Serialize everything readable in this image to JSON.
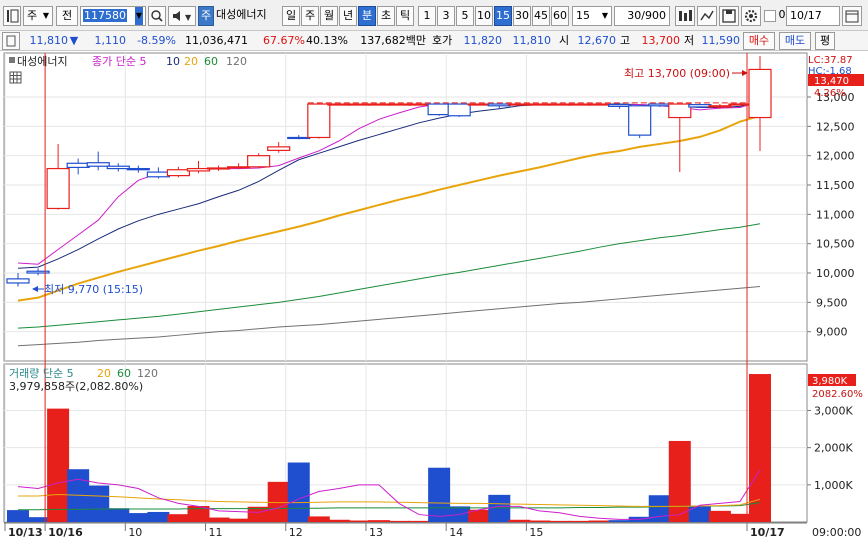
{
  "toolbar": {
    "type_label": "주",
    "stock_type_label": "전",
    "stock_code": "117580",
    "stock_tag": "주",
    "stock_name": "대성에너지",
    "periods": [
      "일",
      "주",
      "월",
      "년",
      "분",
      "초",
      "틱"
    ],
    "selected_period": "분",
    "intervals": [
      "1",
      "3",
      "5",
      "10",
      "15",
      "30",
      "45",
      "60"
    ],
    "selected_interval": "15",
    "interval_value": "15",
    "count": "30/900",
    "date": "10/17",
    "checkbox_value": "0"
  },
  "quote": {
    "price": "11,810",
    "change_arrow": "▼",
    "change": "1,110",
    "change_pct": "-8.59%",
    "volume": "11,036,471",
    "volume_ratio": "67.67%",
    "turnover": "40.13%",
    "amount": "137,682백만",
    "hoga_label": "호가",
    "ask": "11,820",
    "bid": "11,810",
    "open_label": "시",
    "open": "12,670",
    "high_label": "고",
    "high": "13,700",
    "low_label": "저",
    "low": "11,590",
    "buy_label": "매수",
    "sell_label": "매도",
    "eval_label": "평"
  },
  "price_legend": {
    "name": "대성에너지",
    "close_label": "종가 단순 5",
    "ma": [
      "10",
      "20",
      "60",
      "120"
    ]
  },
  "volume_legend": {
    "label": "거래량 단순 5",
    "ma": [
      "20",
      "60",
      "120"
    ],
    "info": "3,979,858주(2,082.80%)"
  },
  "annotations": {
    "high": "최고 13,700 (09:00)",
    "low": "최저 9,770 (15:15)"
  },
  "right_axis": {
    "lc": "LC:37.87",
    "hc": "HC:-1.68",
    "price_tag": "13,470",
    "pct": "4.26%",
    "vol_tag": "3,980K",
    "vol_pct": "2082.60%",
    "time": "09:00:00"
  },
  "colors": {
    "up": "#e8201c",
    "down": "#1f4fcf",
    "ma5": "#cc1fcc",
    "ma10": "#1a2c7a",
    "ma20": "#e8a40a",
    "ma60": "#1a8c3a",
    "ma120": "#707070"
  },
  "chart_data": {
    "type": "candlestick",
    "price_axis": [
      "13,000",
      "12,500",
      "12,000",
      "11,500",
      "11,000",
      "10,500",
      "10,000",
      "9,500",
      "9,000"
    ],
    "volume_axis": [
      "3,000K",
      "2,000K",
      "1,000K"
    ],
    "x_labels": [
      "10/13",
      "10/16",
      "10",
      "11",
      "12",
      "13",
      "14",
      "15",
      "10/17"
    ],
    "candles": [
      {
        "o": 9900,
        "c": 9830,
        "h": 10000,
        "l": 9770,
        "v": 320000
      },
      {
        "o": 10030,
        "c": 10000,
        "h": 10080,
        "l": 9960,
        "v": 130000
      },
      {
        "o": 11100,
        "c": 11780,
        "h": 12200,
        "l": 11080,
        "v": 3050000
      },
      {
        "o": 11870,
        "c": 11800,
        "h": 11950,
        "l": 11680,
        "v": 1420000
      },
      {
        "o": 11880,
        "c": 11820,
        "h": 12070,
        "l": 11750,
        "v": 980000
      },
      {
        "o": 11820,
        "c": 11780,
        "h": 11870,
        "l": 11730,
        "v": 370000
      },
      {
        "o": 11780,
        "c": 11760,
        "h": 11830,
        "l": 11710,
        "v": 240000
      },
      {
        "o": 11720,
        "c": 11640,
        "h": 11800,
        "l": 11610,
        "v": 270000
      },
      {
        "o": 11660,
        "c": 11760,
        "h": 11810,
        "l": 11630,
        "v": 210000
      },
      {
        "o": 11740,
        "c": 11780,
        "h": 11910,
        "l": 11700,
        "v": 430000
      },
      {
        "o": 11780,
        "c": 11790,
        "h": 11830,
        "l": 11740,
        "v": 120000
      },
      {
        "o": 11800,
        "c": 11810,
        "h": 11870,
        "l": 11770,
        "v": 90000
      },
      {
        "o": 11810,
        "c": 12000,
        "h": 12040,
        "l": 11790,
        "v": 410000
      },
      {
        "o": 12090,
        "c": 12150,
        "h": 12230,
        "l": 12050,
        "v": 1080000
      },
      {
        "o": 12310,
        "c": 12300,
        "h": 12350,
        "l": 12280,
        "v": 1600000
      },
      {
        "o": 12310,
        "c": 12880,
        "h": 12900,
        "l": 12290,
        "v": 150000
      },
      {
        "o": 12880,
        "c": 12880,
        "h": 12880,
        "l": 12880,
        "v": 60000
      },
      {
        "o": 12880,
        "c": 12880,
        "h": 12880,
        "l": 12880,
        "v": 40000
      },
      {
        "o": 12880,
        "c": 12880,
        "h": 12880,
        "l": 12880,
        "v": 50000
      },
      {
        "o": 12880,
        "c": 12880,
        "h": 12880,
        "l": 12880,
        "v": 30000
      },
      {
        "o": 12880,
        "c": 12880,
        "h": 12880,
        "l": 12880,
        "v": 30000
      },
      {
        "o": 12880,
        "c": 12700,
        "h": 12880,
        "l": 12680,
        "v": 1460000
      },
      {
        "o": 12880,
        "c": 12680,
        "h": 12880,
        "l": 12660,
        "v": 420000
      },
      {
        "o": 12880,
        "c": 12880,
        "h": 12880,
        "l": 12880,
        "v": 330000
      },
      {
        "o": 12880,
        "c": 12850,
        "h": 12890,
        "l": 12800,
        "v": 730000
      },
      {
        "o": 12880,
        "c": 12880,
        "h": 12880,
        "l": 12880,
        "v": 60000
      },
      {
        "o": 12880,
        "c": 12880,
        "h": 12880,
        "l": 12880,
        "v": 40000
      },
      {
        "o": 12880,
        "c": 12880,
        "h": 12880,
        "l": 12880,
        "v": 30000
      },
      {
        "o": 12880,
        "c": 12880,
        "h": 12880,
        "l": 12880,
        "v": 30000
      },
      {
        "o": 12880,
        "c": 12880,
        "h": 12880,
        "l": 12880,
        "v": 40000
      },
      {
        "o": 12870,
        "c": 12840,
        "h": 12880,
        "l": 12800,
        "v": 50000
      },
      {
        "o": 12850,
        "c": 12350,
        "h": 12860,
        "l": 12300,
        "v": 140000
      },
      {
        "o": 12880,
        "c": 12850,
        "h": 12890,
        "l": 12830,
        "v": 720000
      },
      {
        "o": 12650,
        "c": 12880,
        "h": 12890,
        "l": 11720,
        "v": 2180000
      },
      {
        "o": 12870,
        "c": 12830,
        "h": 12890,
        "l": 12820,
        "v": 420000
      },
      {
        "o": 12830,
        "c": 12850,
        "h": 12880,
        "l": 12800,
        "v": 300000
      },
      {
        "o": 12880,
        "c": 12880,
        "h": 12900,
        "l": 12860,
        "v": 220000
      },
      {
        "o": 12650,
        "c": 13470,
        "h": 13700,
        "l": 12080,
        "v": 3980000
      }
    ],
    "ma5": [
      10170,
      10150,
      10400,
      10650,
      10900,
      11300,
      11580,
      11700,
      11740,
      11760,
      11780,
      11780,
      11790,
      11830,
      11960,
      12080,
      12250,
      12460,
      12620,
      12730,
      12830,
      12880,
      12880,
      12880,
      12880,
      12880,
      12880,
      12880,
      12880,
      12870,
      12870,
      12870,
      12850,
      12820,
      12780,
      12810,
      12820,
      12920
    ],
    "ma10": [
      10080,
      10100,
      10240,
      10400,
      10580,
      10750,
      10890,
      11000,
      11090,
      11180,
      11300,
      11410,
      11560,
      11750,
      11930,
      12040,
      12150,
      12260,
      12360,
      12460,
      12560,
      12640,
      12710,
      12760,
      12800,
      12850,
      12870,
      12880,
      12880,
      12880,
      12880,
      12870,
      12860,
      12840,
      12820,
      12820,
      12840,
      12920
    ],
    "ma20": [
      9530,
      9580,
      9700,
      9820,
      9920,
      10020,
      10110,
      10200,
      10290,
      10380,
      10460,
      10550,
      10630,
      10710,
      10790,
      10880,
      10980,
      11070,
      11160,
      11250,
      11330,
      11420,
      11500,
      11580,
      11660,
      11730,
      11800,
      11880,
      11960,
      12030,
      12080,
      12150,
      12200,
      12250,
      12320,
      12430,
      12580,
      12680
    ],
    "ma60": [
      9060,
      9080,
      9110,
      9140,
      9170,
      9200,
      9230,
      9260,
      9300,
      9340,
      9380,
      9420,
      9460,
      9500,
      9550,
      9600,
      9660,
      9720,
      9780,
      9840,
      9900,
      9960,
      10010,
      10070,
      10130,
      10190,
      10250,
      10310,
      10370,
      10440,
      10500,
      10550,
      10600,
      10640,
      10690,
      10740,
      10780,
      10840
    ],
    "ma120": [
      8760,
      8780,
      8800,
      8820,
      8850,
      8870,
      8890,
      8910,
      8940,
      8970,
      9000,
      9020,
      9050,
      9080,
      9100,
      9120,
      9150,
      9180,
      9210,
      9240,
      9270,
      9300,
      9330,
      9360,
      9390,
      9420,
      9450,
      9480,
      9500,
      9530,
      9560,
      9590,
      9620,
      9650,
      9680,
      9710,
      9740,
      9770
    ],
    "vol_ma5": [
      950000,
      900000,
      1050000,
      1150000,
      1050000,
      1000000,
      900000,
      650000,
      500000,
      420000,
      300000,
      280000,
      260000,
      380000,
      620000,
      820000,
      900000,
      1000000,
      1000000,
      500000,
      200000,
      150000,
      200000,
      330000,
      420000,
      420000,
      300000,
      250000,
      150000,
      100000,
      70000,
      70000,
      150000,
      200000,
      450000,
      500000,
      550000,
      1400000
    ],
    "vol_ma20": [
      700000,
      700000,
      740000,
      720000,
      700000,
      680000,
      650000,
      620000,
      600000,
      570000,
      550000,
      540000,
      530000,
      520000,
      520000,
      530000,
      540000,
      540000,
      540000,
      530000,
      520000,
      510000,
      500000,
      500000,
      490000,
      480000,
      470000,
      460000,
      450000,
      440000,
      430000,
      420000,
      420000,
      420000,
      430000,
      440000,
      460000,
      610000
    ],
    "vol_ma60": [
      330000,
      330000,
      340000,
      340000,
      350000,
      350000,
      350000,
      350000,
      350000,
      360000,
      360000,
      360000,
      360000,
      360000,
      370000,
      370000,
      380000,
      380000,
      380000,
      380000,
      380000,
      380000,
      380000,
      380000,
      380000,
      380000,
      380000,
      380000,
      390000,
      390000,
      400000,
      400000,
      410000,
      420000,
      430000,
      430000,
      440000,
      520000
    ]
  }
}
